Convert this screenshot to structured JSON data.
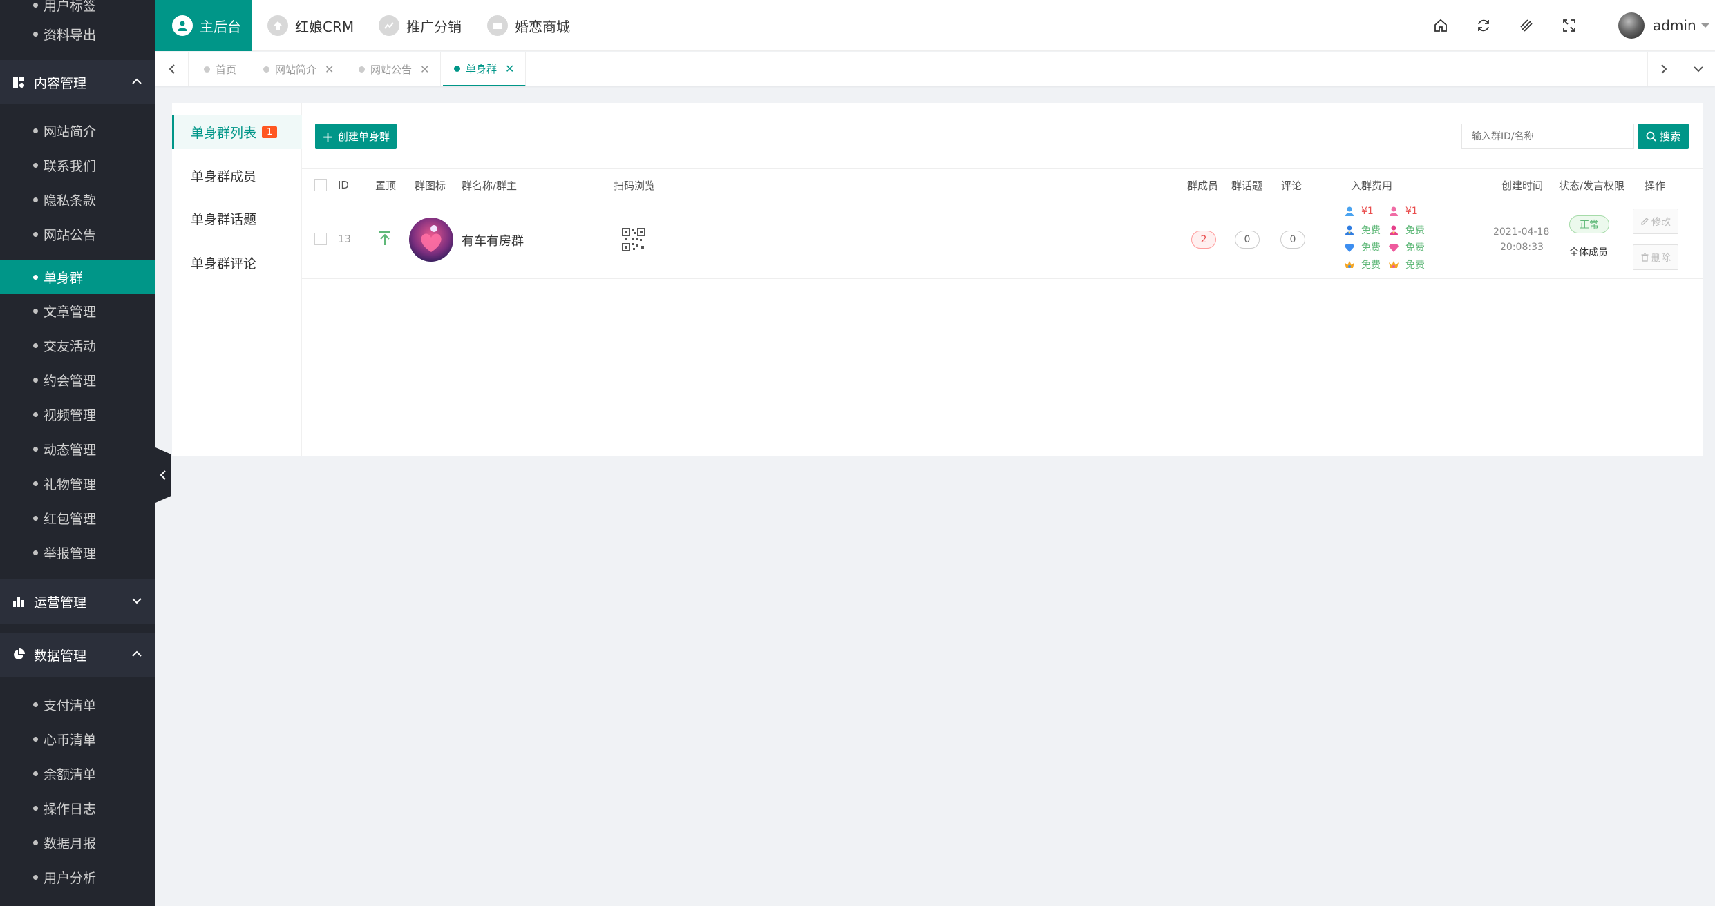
{
  "sidebar": {
    "top_items": [
      {
        "label": "用户标签"
      },
      {
        "label": "资料导出"
      }
    ],
    "group_content": {
      "label": "内容管理"
    },
    "content_items": [
      {
        "label": "网站简介"
      },
      {
        "label": "联系我们"
      },
      {
        "label": "隐私条款"
      },
      {
        "label": "网站公告"
      },
      {
        "label": "单身群"
      },
      {
        "label": "文章管理"
      },
      {
        "label": "交友活动"
      },
      {
        "label": "约会管理"
      },
      {
        "label": "视频管理"
      },
      {
        "label": "动态管理"
      },
      {
        "label": "礼物管理"
      },
      {
        "label": "红包管理"
      },
      {
        "label": "举报管理"
      }
    ],
    "group_ops": {
      "label": "运营管理"
    },
    "group_data": {
      "label": "数据管理"
    },
    "data_items": [
      {
        "label": "支付清单"
      },
      {
        "label": "心币清单"
      },
      {
        "label": "余额清单"
      },
      {
        "label": "操作日志"
      },
      {
        "label": "数据月报"
      },
      {
        "label": "用户分析"
      }
    ]
  },
  "topnav": {
    "items": [
      {
        "label": "主后台"
      },
      {
        "label": "红娘CRM"
      },
      {
        "label": "推广分销"
      },
      {
        "label": "婚恋商城"
      }
    ],
    "user": "admin"
  },
  "tabs": [
    {
      "label": "首页"
    },
    {
      "label": "网站简介"
    },
    {
      "label": "网站公告"
    },
    {
      "label": "单身群"
    }
  ],
  "subnav": {
    "items": [
      {
        "label": "单身群列表"
      },
      {
        "label": "单身群成员"
      },
      {
        "label": "单身群话题"
      },
      {
        "label": "单身群评论"
      }
    ],
    "badge": "1"
  },
  "toolbar": {
    "create_label": "创建单身群",
    "search_placeholder": "输入群ID/名称",
    "search_label": "搜索"
  },
  "table": {
    "headers": {
      "id": "ID",
      "top": "置顶",
      "icon": "群图标",
      "name": "群名称/群主",
      "qr": "扫码浏览",
      "members": "群成员",
      "topics": "群话题",
      "comments": "评论",
      "fee": "入群费用",
      "created": "创建时间",
      "status": "状态/发言权限",
      "ops": "操作"
    },
    "rows": [
      {
        "id": "13",
        "name": "有车有房群",
        "members": "2",
        "topics": "0",
        "comments": "0",
        "fees": [
          [
            "¥1",
            "¥1"
          ],
          [
            "免费",
            "免费"
          ],
          [
            "免费",
            "免费"
          ],
          [
            "免费",
            "免费"
          ]
        ],
        "created_date": "2021-04-18",
        "created_time": "20:08:33",
        "status": "正常",
        "permission": "全体成员",
        "edit_label": "修改",
        "delete_label": "删除"
      }
    ]
  },
  "colors": {
    "accent": "#009688",
    "sidebar_bg": "#23262e",
    "badge": "#ff5722",
    "free": "#5fb878",
    "price": "#e94d4d"
  }
}
